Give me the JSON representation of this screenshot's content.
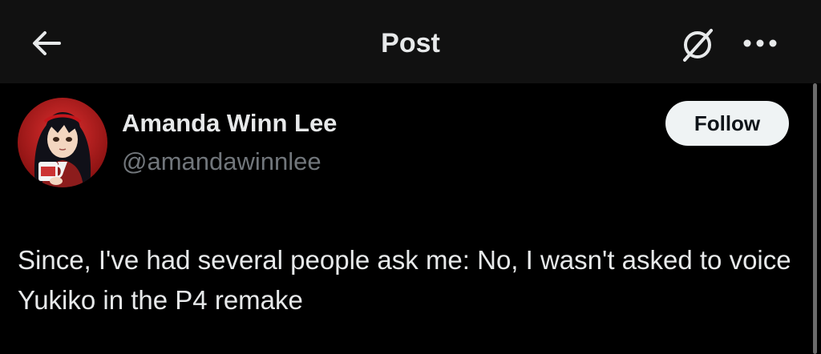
{
  "header": {
    "title": "Post",
    "back_icon": "arrow-left-icon",
    "grok_icon": "grok-slash-circle-icon",
    "more_icon": "more-horizontal-icon"
  },
  "author": {
    "display_name": "Amanda Winn Lee",
    "handle": "@amandawinnlee",
    "avatar_icon": "anime-character-avatar"
  },
  "actions": {
    "follow_label": "Follow"
  },
  "tweet": {
    "text": "Since, I've had several people ask me: No, I wasn't asked to voice Yukiko in the P4 remake"
  },
  "colors": {
    "background": "#000000",
    "header_background": "#111111",
    "primary_text": "#e7e9ea",
    "secondary_text": "#71767b",
    "follow_button_bg": "#eff3f4",
    "follow_button_text": "#0f1419"
  }
}
